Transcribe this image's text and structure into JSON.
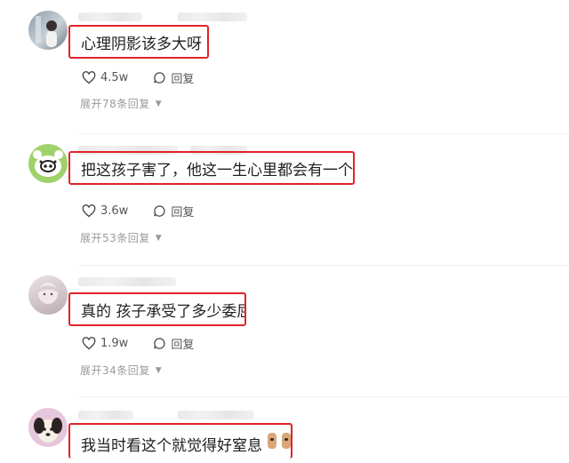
{
  "comments": [
    {
      "text": "心理阴影该多大呀",
      "likes": "4.5w",
      "reply_label": "回复",
      "expand_label": "展开78条回复"
    },
    {
      "text": "把这孩子害了，他这一生心里都会有一个痛处",
      "likes": "3.6w",
      "reply_label": "回复",
      "expand_label": "展开53条回复"
    },
    {
      "text": "真的 孩子承受了多少委屈",
      "likes": "1.9w",
      "reply_label": "回复",
      "expand_label": "展开34条回复"
    },
    {
      "text": "我当时看这个就觉得好窒息"
    }
  ],
  "colors": {
    "highlight_border": "#e0242a",
    "muted_text": "#9a9a9a"
  }
}
